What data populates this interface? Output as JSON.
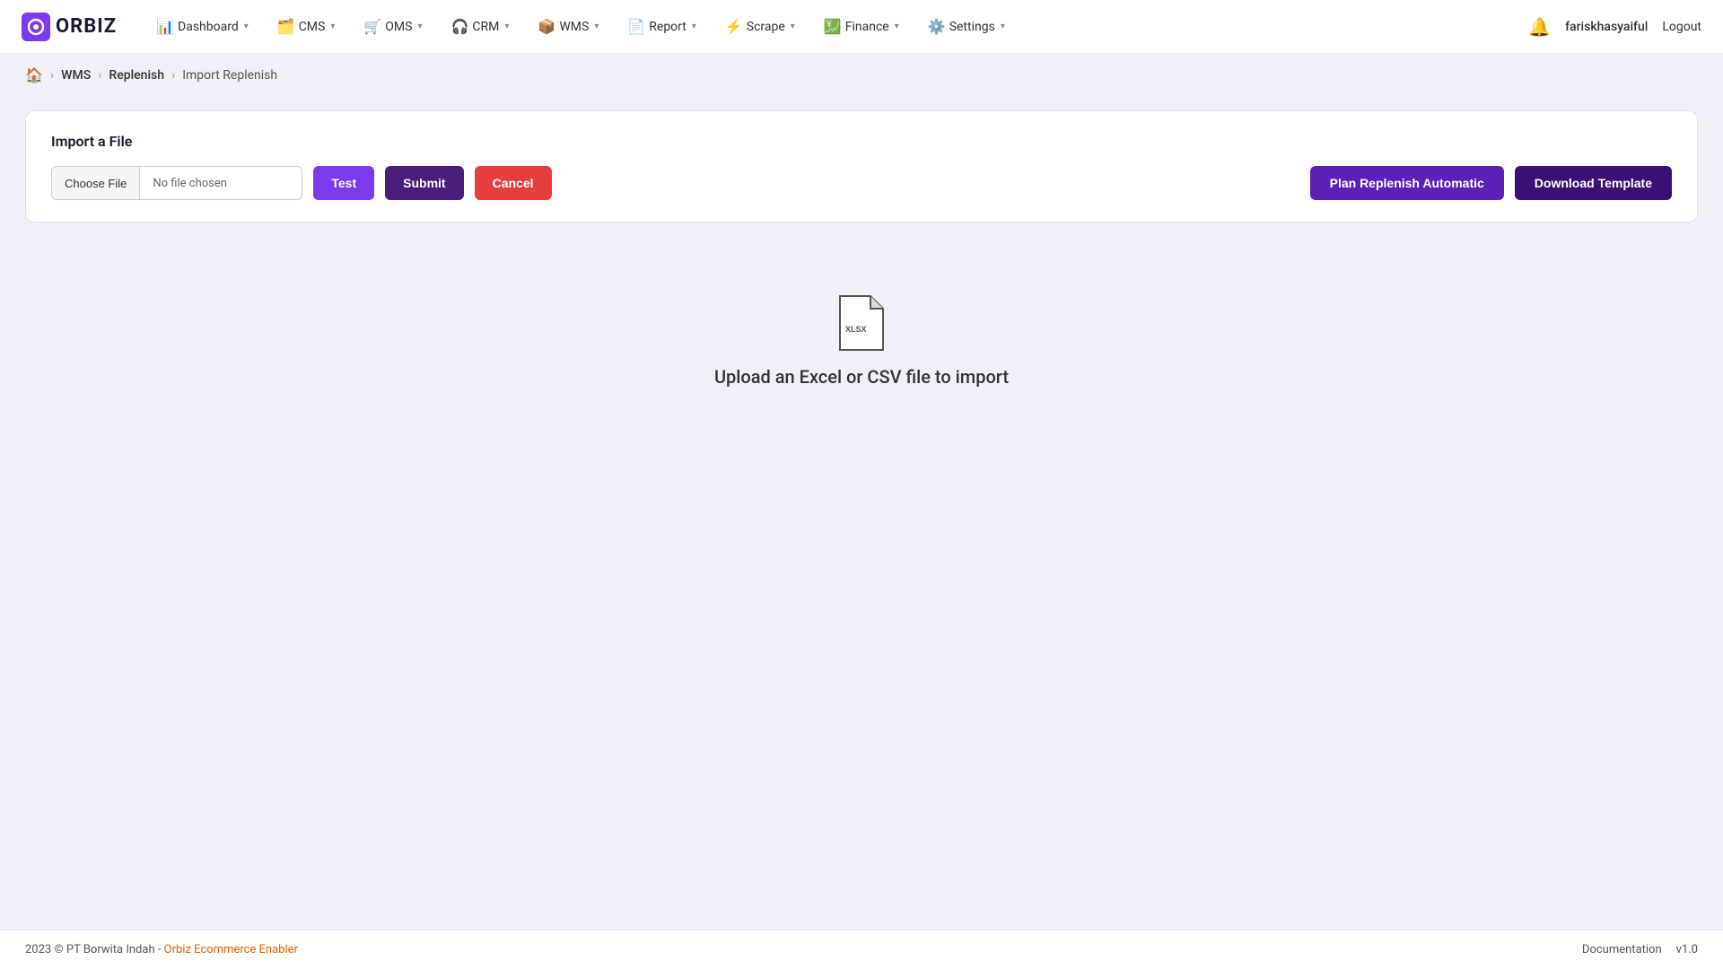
{
  "logo": {
    "text": "ORBIZ"
  },
  "nav": {
    "items": [
      {
        "id": "dashboard",
        "label": "Dashboard",
        "icon": "📊"
      },
      {
        "id": "cms",
        "label": "CMS",
        "icon": "🗂️"
      },
      {
        "id": "oms",
        "label": "OMS",
        "icon": "🛒"
      },
      {
        "id": "crm",
        "label": "CRM",
        "icon": "🎧"
      },
      {
        "id": "wms",
        "label": "WMS",
        "icon": "📦"
      },
      {
        "id": "report",
        "label": "Report",
        "icon": "📄"
      },
      {
        "id": "scrape",
        "label": "Scrape",
        "icon": "⚡"
      },
      {
        "id": "finance",
        "label": "Finance",
        "icon": "💹"
      },
      {
        "id": "settings",
        "label": "Settings",
        "icon": "⚙️"
      }
    ],
    "username": "fariskhasyaiful",
    "logout_label": "Logout"
  },
  "breadcrumb": {
    "home_icon": "🏠",
    "wms_label": "WMS",
    "replenish_label": "Replenish",
    "current_label": "Import Replenish"
  },
  "import": {
    "title": "Import a File",
    "choose_file_label": "Choose File",
    "no_file_label": "No file chosen",
    "test_label": "Test",
    "submit_label": "Submit",
    "cancel_label": "Cancel",
    "plan_replenish_label": "Plan Replenish Automatic",
    "download_template_label": "Download Template",
    "upload_text": "Upload an Excel or CSV file to import"
  },
  "footer": {
    "copyright": "2023 © PT Borwita Indah - ",
    "link_label": "Orbiz Ecommerce Enabler",
    "documentation_label": "Documentation",
    "version_label": "v1.0"
  }
}
